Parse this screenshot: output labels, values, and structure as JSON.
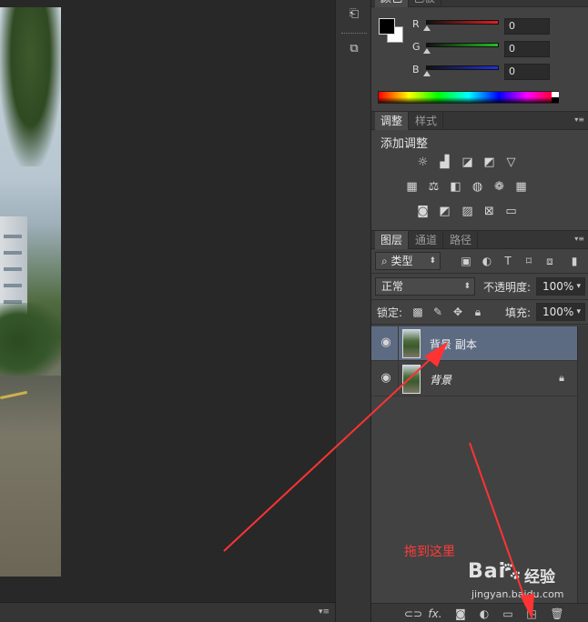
{
  "color_panel": {
    "tabs": [
      {
        "label": "颜色"
      },
      {
        "label": "色板"
      }
    ],
    "channels": [
      {
        "label": "R",
        "value": "0",
        "color": "#e02020"
      },
      {
        "label": "G",
        "value": "0",
        "color": "#20c020"
      },
      {
        "label": "B",
        "value": "0",
        "color": "#2030e0"
      }
    ],
    "foreground": "#000000",
    "background": "#ffffff"
  },
  "adjust_panel": {
    "tabs": [
      {
        "label": "调整"
      },
      {
        "label": "样式"
      }
    ],
    "title": "添加调整",
    "icons_row1": [
      "brightness-icon",
      "levels-icon",
      "curves-icon",
      "exposure-icon",
      "vibrance-icon"
    ],
    "icons_row2": [
      "hue-saturation-icon",
      "color-balance-icon",
      "black-white-icon",
      "photo-filter-icon",
      "channel-mixer-icon",
      "color-lookup-icon"
    ],
    "icons_row3": [
      "invert-icon",
      "posterize-icon",
      "threshold-icon",
      "selective-color-icon",
      "gradient-map-icon"
    ]
  },
  "layers_panel": {
    "tabs": [
      {
        "label": "图层"
      },
      {
        "label": "通道"
      },
      {
        "label": "路径"
      }
    ],
    "filter_label": "类型",
    "blend_mode": "正常",
    "opacity_label": "不透明度:",
    "opacity_value": "100%",
    "lock_label": "锁定:",
    "fill_label": "填充:",
    "fill_value": "100%",
    "layers": [
      {
        "name": "背景 副本",
        "selected": true,
        "locked": false
      },
      {
        "name": "背景",
        "selected": false,
        "locked": true
      }
    ],
    "footer_fx": "fx."
  },
  "annotation": {
    "text": "拖到这里",
    "color": "#ff3b3b"
  },
  "watermark": {
    "brand": "Bai",
    "brand_cn": "经验",
    "url": "jingyan.baidu.com"
  },
  "selected_color": "#5d6b82"
}
